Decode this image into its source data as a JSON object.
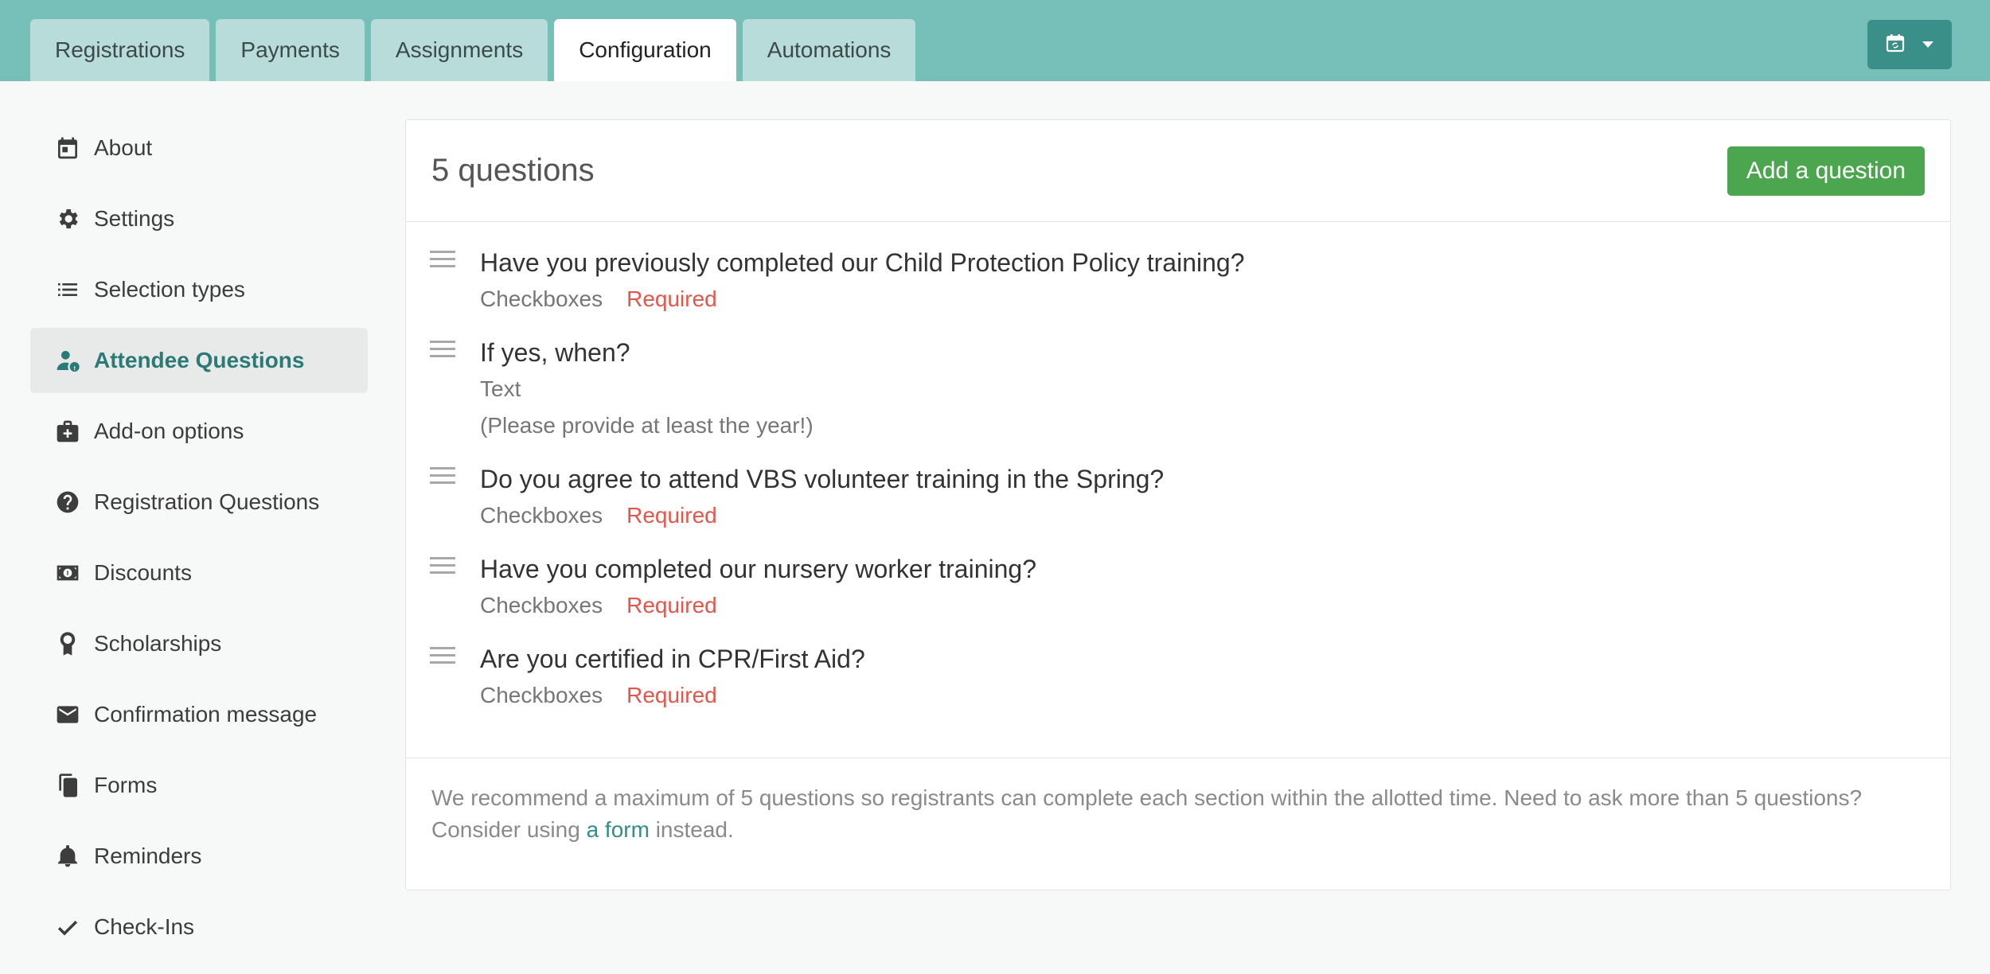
{
  "tabs": [
    {
      "label": "Registrations"
    },
    {
      "label": "Payments"
    },
    {
      "label": "Assignments"
    },
    {
      "label": "Configuration",
      "active": true
    },
    {
      "label": "Automations"
    }
  ],
  "header_button": {
    "icon": "calendar-sync-icon",
    "dropdown_icon": "caret-down-icon"
  },
  "sidebar": {
    "items": [
      {
        "label": "About",
        "icon": "calendar-icon"
      },
      {
        "label": "Settings",
        "icon": "gear-icon"
      },
      {
        "label": "Selection types",
        "icon": "list-icon"
      },
      {
        "label": "Attendee Questions",
        "icon": "user-question-icon",
        "active": true
      },
      {
        "label": "Add-on options",
        "icon": "medical-bag-icon"
      },
      {
        "label": "Registration Questions",
        "icon": "question-circle-icon"
      },
      {
        "label": "Discounts",
        "icon": "money-icon"
      },
      {
        "label": "Scholarships",
        "icon": "award-icon"
      },
      {
        "label": "Confirmation message",
        "icon": "envelope-icon"
      },
      {
        "label": "Forms",
        "icon": "documents-icon"
      },
      {
        "label": "Reminders",
        "icon": "bell-icon"
      },
      {
        "label": "Check-Ins",
        "icon": "checkmark-icon"
      }
    ]
  },
  "main": {
    "title": "5 questions",
    "add_button": "Add a question",
    "questions": [
      {
        "title": "Have you previously completed our Child Protection Policy training?",
        "type": "Checkboxes",
        "required": "Required"
      },
      {
        "title": "If yes, when?",
        "type": "Text",
        "help": "(Please provide at least the year!)"
      },
      {
        "title": "Do you agree to attend VBS volunteer training in the Spring?",
        "type": "Checkboxes",
        "required": "Required"
      },
      {
        "title": "Have you completed our nursery worker training?",
        "type": "Checkboxes",
        "required": "Required"
      },
      {
        "title": "Are you certified in CPR/First Aid?",
        "type": "Checkboxes",
        "required": "Required"
      }
    ],
    "footer": {
      "text_before": "We recommend a maximum of 5 questions so registrants can complete each section within the allotted time. Need to ask more than 5 questions? Consider using ",
      "link": "a form",
      "text_after": " instead."
    }
  },
  "colors": {
    "header_bg": "#76bfb9",
    "accent": "#2b7a75",
    "add_button": "#4ca64f",
    "required": "#e5554a"
  }
}
